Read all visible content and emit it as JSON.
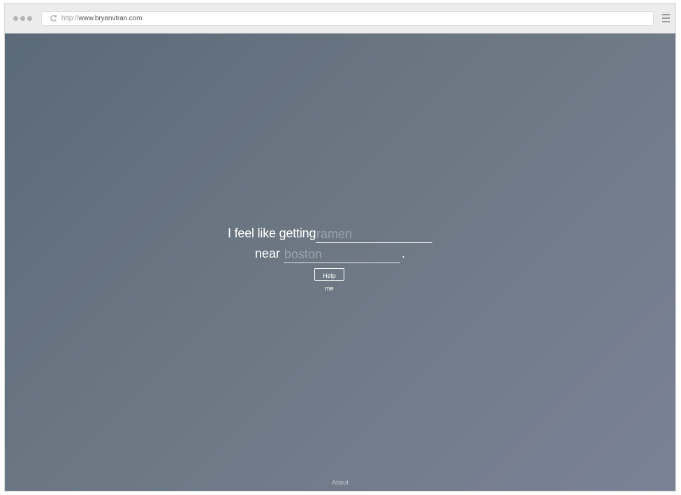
{
  "browser": {
    "url_scheme": "http://",
    "url_host": "www.bryanvtran.com",
    "reload_icon": "reload-icon",
    "menu_icon": "hamburger-menu-icon"
  },
  "form": {
    "phrase_feel": "I feel like getting",
    "food_placeholder": "ramen",
    "phrase_near": "near",
    "location_placeholder": "boston",
    "period": ".",
    "submit_label": "Help me"
  },
  "footer": {
    "about_label": "About"
  },
  "colors": {
    "background_top_left": "#5b6a79",
    "background_bottom_right": "#7a8296",
    "text": "#ffffff",
    "placeholder": "#9aa3ad"
  }
}
